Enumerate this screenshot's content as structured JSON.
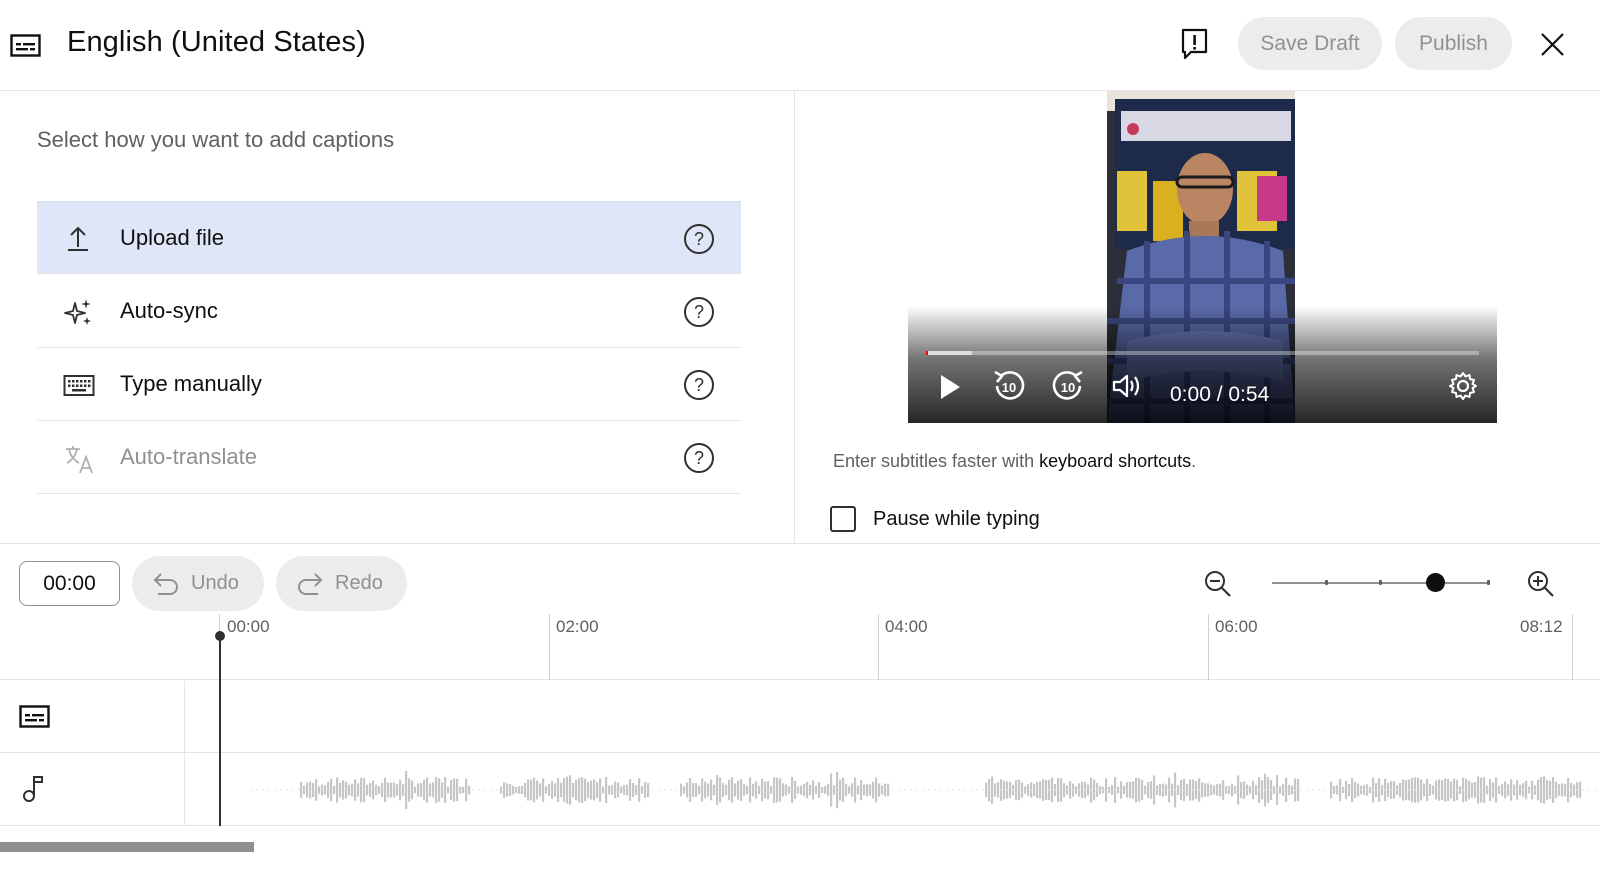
{
  "header": {
    "title": "English (United States)",
    "save_draft_label": "Save Draft",
    "publish_label": "Publish",
    "icons": [
      "captions-icon",
      "feedback-icon",
      "close-icon"
    ]
  },
  "left_panel": {
    "prompt": "Select how you want to add captions",
    "options": [
      {
        "label": "Upload file",
        "icon": "upload-icon",
        "selected": true,
        "enabled": true
      },
      {
        "label": "Auto-sync",
        "icon": "sparkle-icon",
        "selected": false,
        "enabled": true
      },
      {
        "label": "Type manually",
        "icon": "keyboard-icon",
        "selected": false,
        "enabled": true
      },
      {
        "label": "Auto-translate",
        "icon": "translate-icon",
        "selected": false,
        "enabled": false
      }
    ]
  },
  "video": {
    "time_display": "0:00 / 0:54",
    "controls": [
      "play-icon",
      "rewind-10-icon",
      "forward-10-icon",
      "volume-icon",
      "settings-icon"
    ]
  },
  "hint": {
    "prefix": "Enter subtitles faster with ",
    "link": "keyboard shortcuts",
    "suffix": "."
  },
  "pause_while_typing": {
    "label": "Pause while typing",
    "checked": false
  },
  "timeline": {
    "current_time": "00:00",
    "undo_label": "Undo",
    "redo_label": "Redo",
    "ruler_labels": [
      "00:00",
      "02:00",
      "04:00",
      "06:00",
      "08:12"
    ],
    "zoom_level": 0.75,
    "track_icons": [
      "captions-track-icon",
      "music-note-icon"
    ]
  },
  "colors": {
    "selected_option_bg": "#dfe6f7",
    "disabled_text": "#909090",
    "progress_played": "#ff0000"
  }
}
